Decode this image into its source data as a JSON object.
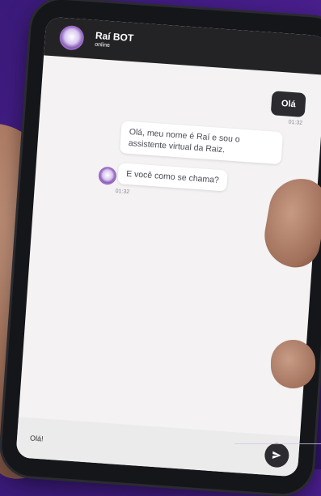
{
  "chat": {
    "bot_name": "Raí BOT",
    "status": "online",
    "avatar_icon": "robot-avatar-icon"
  },
  "messages": [
    {
      "from": "user",
      "text": "Olá",
      "time": "01:32"
    },
    {
      "from": "bot",
      "text": "Olá, meu nome é Raí e sou o assistente virtual da Raiz."
    },
    {
      "from": "bot",
      "text": "E você como se chama?",
      "time": "01:32"
    }
  ],
  "composer": {
    "value": "Olá!",
    "send_icon": "send-icon"
  },
  "colors": {
    "background_purple": "#4b1f8f",
    "header_dark": "#232326",
    "bubble_dark": "#2b2b30",
    "accent_purple": "#9a6cc9"
  }
}
